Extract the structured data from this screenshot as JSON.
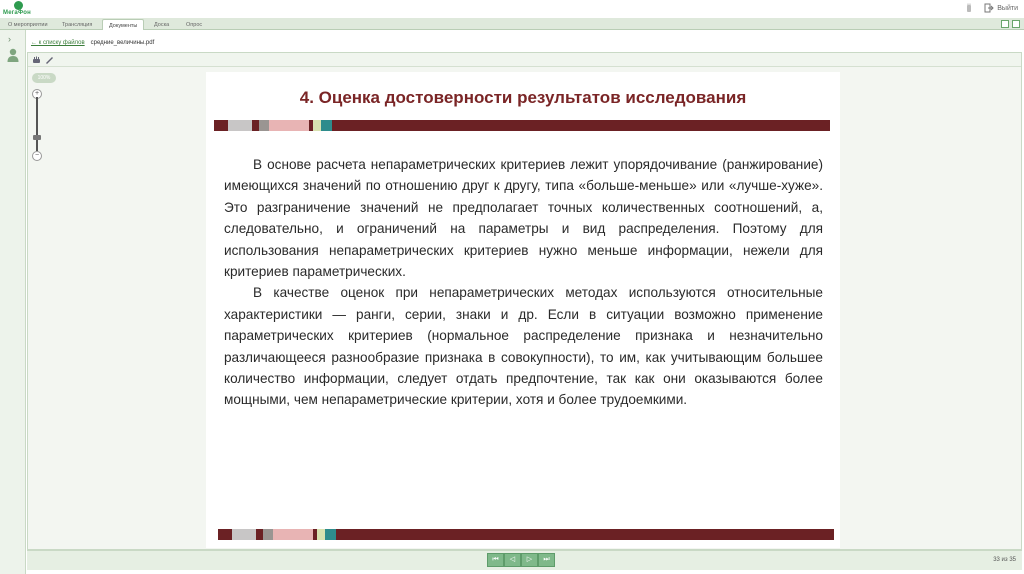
{
  "app": {
    "logo_text": "МегаФон"
  },
  "header": {
    "logout_label": "Выйти"
  },
  "tabs": [
    {
      "label": "О мероприятии"
    },
    {
      "label": "Трансляция"
    },
    {
      "label": "Документы"
    },
    {
      "label": "Доска"
    },
    {
      "label": "Опрос"
    }
  ],
  "breadcrumb": {
    "back_label": "← к списку файлов",
    "file_name": "средние_величины.pdf"
  },
  "viewer": {
    "zoom_label": "100%"
  },
  "slide": {
    "title": "4. Оценка достоверности результатов исследования",
    "paragraphs": [
      "В основе расчета непараметрических критериев лежит упорядочивание (ранжирование) имеющихся значений по отношению друг к другу, типа «больше-меньше» или «лучше-хуже». Это разграничение значений не предполагает точных количественных соотношений, а, следовательно, и ограничений на параметры и вид распределения. Поэтому для использования непараметрических критериев нужно меньше информации, нежели для критериев параметрических.",
      "В качестве оценок при непараметрических методах используются относительные характеристики — ранги, серии, знаки и др. Если в ситуации возможно применение параметрических критериев (нормальное распределение признака и незначительно различающееся разнообразие признака в совокупности), то им, как учитывающим большее количество информации, следует отдать предпочтение, так как они оказываются более мощными, чем непараметрические критерии, хотя и более трудоемкими."
    ],
    "bar_colors": [
      "#6b2124",
      "#c8c6c6",
      "#6b2124",
      "#9a9592",
      "#e8b4b4",
      "#6b2124",
      "#d8e2b0",
      "#2e8c8c"
    ]
  },
  "pager": {
    "first": "⏮",
    "prev": "◁",
    "next": "▷",
    "last": "⏭",
    "current": "33",
    "total_label": "из 35"
  }
}
